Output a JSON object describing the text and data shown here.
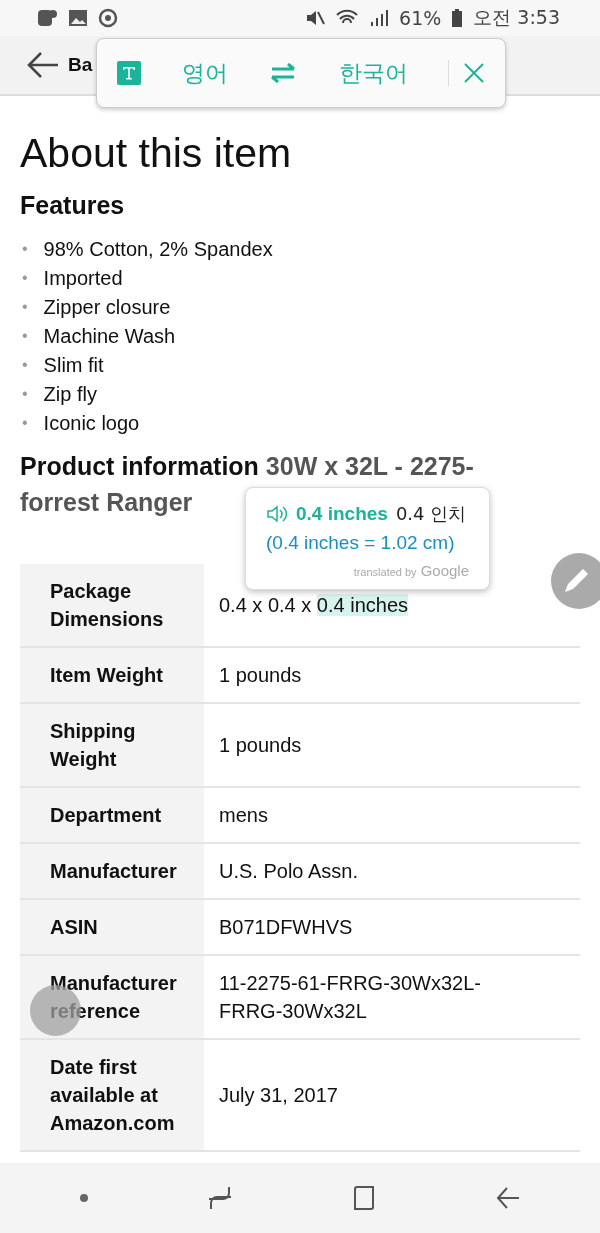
{
  "status_bar": {
    "battery": "61%",
    "time": "오전 3:53"
  },
  "header": {
    "back_label": "Ba"
  },
  "translate_bar": {
    "source": "영어",
    "target": "한국어"
  },
  "title": "About this item",
  "features_heading": "Features",
  "features": [
    {
      "marker": "•",
      "text": "98% Cotton, 2% Spandex"
    },
    {
      "marker": "•",
      "text": "Imported"
    },
    {
      "marker": "•",
      "text": "Zipper closure"
    },
    {
      "marker": "•",
      "text": "Machine Wash"
    },
    {
      "marker": "•",
      "text": "Slim fit"
    },
    {
      "marker": "•",
      "text": "Zip fly"
    },
    {
      "marker": "•",
      "text": "Iconic logo"
    }
  ],
  "product_info": {
    "heading": "Product information",
    "subtitle_lines": [
      "30W x 32L - 2275-",
      "forrest Ranger"
    ]
  },
  "table": {
    "rows": [
      {
        "label": "Package Dimensions",
        "value": "0.4 x 0.4 x ",
        "selection": "0.4 inches"
      },
      {
        "label": "Item Weight",
        "value": "1 pounds"
      },
      {
        "label": "Shipping Weight",
        "value": "1 pounds"
      },
      {
        "label": "Department",
        "value": "mens"
      },
      {
        "label": "Manufacturer",
        "value": "U.S. Polo Assn."
      },
      {
        "label": "ASIN",
        "value": "B071DFWHVS"
      },
      {
        "label": "Manufacturer reference",
        "value": "11-2275-61-FRRG-30Wx32L-FRRG-30Wx32L"
      },
      {
        "label": "Date first available at Amazon.com",
        "value": "July 31, 2017"
      }
    ]
  },
  "translation_popup": {
    "word": "0.4 inches",
    "translation": "0.4 인치",
    "conversion": "(0.4 inches = 1.02 cm)",
    "credit_prefix": "translated by",
    "credit_brand": "Google"
  }
}
